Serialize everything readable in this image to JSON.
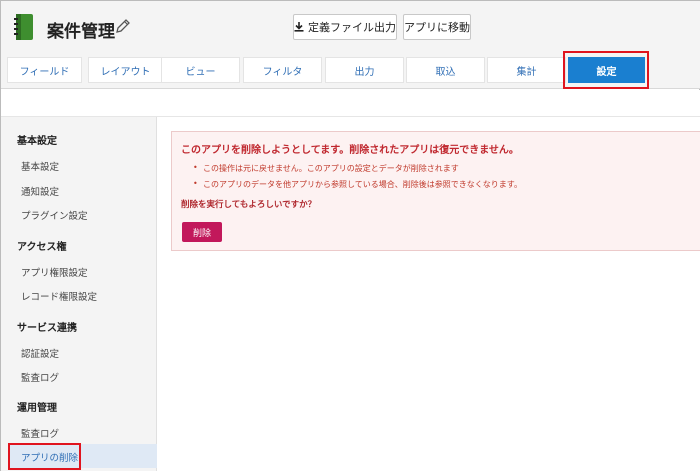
{
  "header": {
    "app_title": "案件管理",
    "export_button": "定義ファイル出力",
    "goto_app_button": "アプリに移動"
  },
  "tabs": [
    {
      "label": "フィールド"
    },
    {
      "label": "レイアウト"
    },
    {
      "label": "ビュー"
    },
    {
      "label": "フィルタ"
    },
    {
      "label": "出力"
    },
    {
      "label": "取込"
    },
    {
      "label": "集計"
    },
    {
      "label": "設定",
      "active": true
    }
  ],
  "sidebar": {
    "sections": [
      {
        "heading": "基本設定",
        "items": [
          "基本設定",
          "通知設定",
          "プラグイン設定"
        ]
      },
      {
        "heading": "アクセス権",
        "items": [
          "アプリ権限設定",
          "レコード権限設定"
        ]
      },
      {
        "heading": "サービス連携",
        "items": [
          "認証設定",
          "監査ログ"
        ]
      },
      {
        "heading": "運用管理",
        "items": [
          "監査ログ"
        ]
      }
    ],
    "active_item": "アプリの削除"
  },
  "main": {
    "alert_title": "このアプリを削除しようとしてます。削除されたアプリは復元できません。",
    "bullets": [
      "この操作は元に戻せません。このアプリの設定とデータが削除されます",
      "このアプリのデータを他アプリから参照している場合、削除後は参照できなくなります。"
    ],
    "confirm_text": "削除を実行してもよろしいですか？",
    "delete_button": "削除"
  },
  "colors": {
    "accent": "#1a7fd0",
    "danger": "#c2185b",
    "highlight": "#e0141e"
  }
}
